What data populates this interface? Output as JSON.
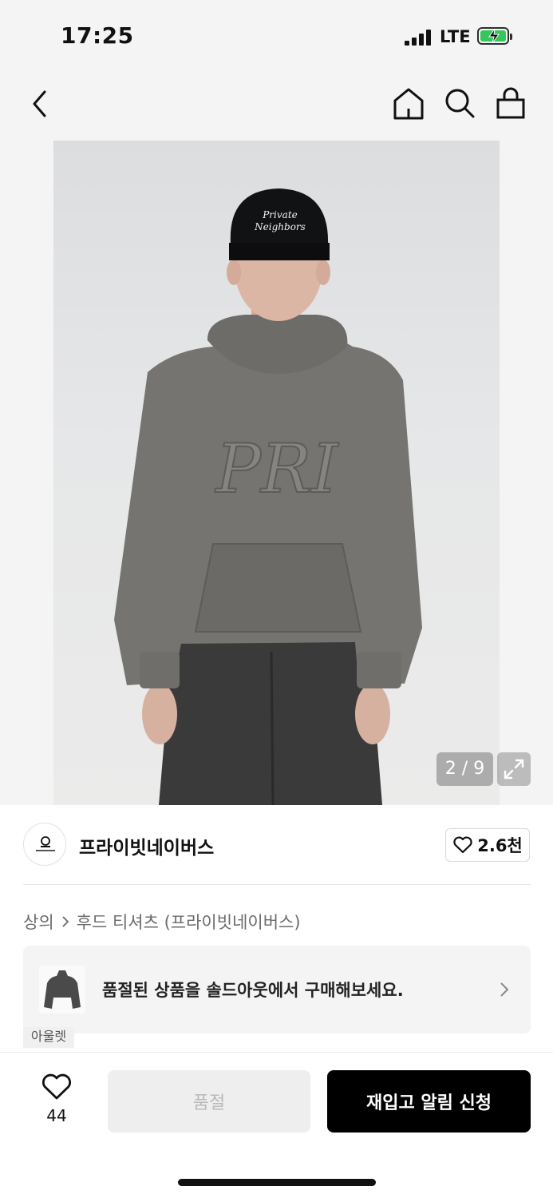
{
  "status_bar": {
    "time": "17:25",
    "network": "LTE"
  },
  "nav": {
    "icons": [
      "back-icon",
      "home-icon",
      "search-icon",
      "shopping-bag-icon"
    ]
  },
  "product_image": {
    "counter": "2 / 9",
    "cap_text_line1": "Private",
    "cap_text_line2": "Neighbors",
    "hoodie_graphic": "PRI"
  },
  "brand": {
    "name": "프라이빗네이버스",
    "likes": "2.6천"
  },
  "breadcrumb": {
    "category": "상의",
    "subcategory": "후드 티셔츠 (프라이빗네이버스)"
  },
  "soldout_banner": {
    "text": "품절된 상품을 솔드아웃에서 구매해보세요."
  },
  "outlet_tag": "아울렛",
  "bottom_bar": {
    "wish_count": "44",
    "soldout_label": "품절",
    "restock_label": "재입고 알림 신청"
  },
  "colors": {
    "accent": "#000000",
    "battery": "#34c759"
  }
}
